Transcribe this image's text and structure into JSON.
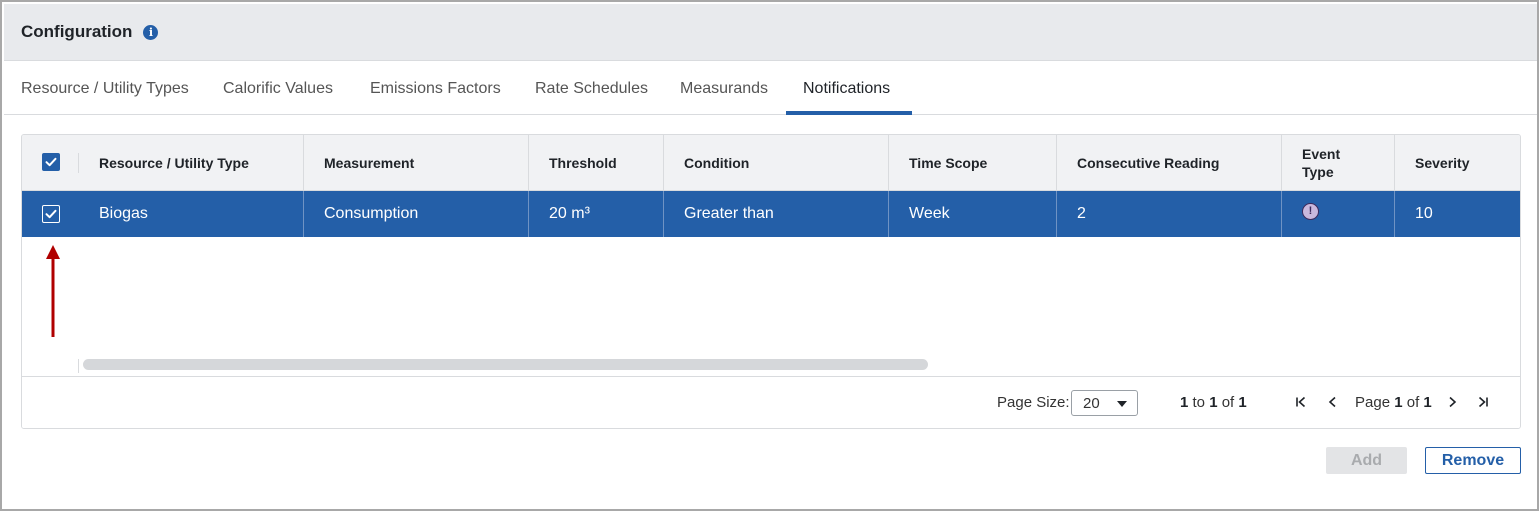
{
  "header": {
    "title": "Configuration",
    "info_icon": "info-icon"
  },
  "tabs": [
    {
      "label": "Resource / Utility Types",
      "active": false
    },
    {
      "label": "Calorific Values",
      "active": false
    },
    {
      "label": "Emissions Factors",
      "active": false
    },
    {
      "label": "Rate Schedules",
      "active": false
    },
    {
      "label": "Measurands",
      "active": false
    },
    {
      "label": "Notifications",
      "active": true
    }
  ],
  "grid": {
    "select_all_checked": true,
    "columns": [
      {
        "label": "Resource / Utility Type"
      },
      {
        "label": "Measurement"
      },
      {
        "label": "Threshold"
      },
      {
        "label": "Condition"
      },
      {
        "label": "Time Scope"
      },
      {
        "label": "Consecutive Reading"
      },
      {
        "label": "Event Type"
      },
      {
        "label": "Severity"
      }
    ],
    "rows": [
      {
        "selected": true,
        "resource": "Biogas",
        "measurement": "Consumption",
        "threshold": "20 m³",
        "condition": "Greater than",
        "time_scope": "Week",
        "consecutive_reading": "2",
        "event_type_icon": "warning-circle-icon",
        "severity": "10"
      }
    ]
  },
  "pagination": {
    "page_size_label": "Page Size:",
    "page_size_value": "20",
    "range_from": "1",
    "range_to_word": "to",
    "range_to": "1",
    "range_of_word": "of",
    "range_total": "1",
    "page_word": "Page",
    "page_current": "1",
    "page_of_word": "of",
    "page_total": "1"
  },
  "actions": {
    "add_label": "Add",
    "add_disabled": true,
    "remove_label": "Remove"
  },
  "colors": {
    "accent": "#245fa8",
    "annotation_arrow": "#b00000",
    "header_bg": "#e8eaed"
  }
}
